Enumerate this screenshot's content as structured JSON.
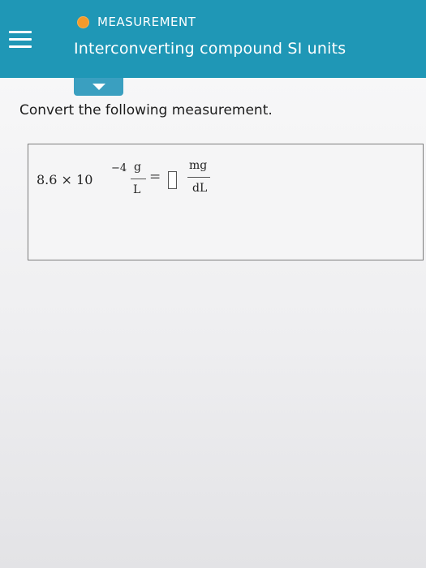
{
  "header": {
    "topic_label": "MEASUREMENT",
    "title": "Interconverting compound SI units",
    "accent_color": "#1f97b6",
    "topic_dot_color": "#f39a2b",
    "menu_icon": "hamburger-menu-icon"
  },
  "toggle": {
    "icon": "caret-down-icon"
  },
  "question": {
    "instruction": "Convert the following measurement.",
    "coefficient": "8.6 × 10",
    "exponent": "−4",
    "given_unit_numerator": "g",
    "given_unit_denominator": "L",
    "equals": "=",
    "answer_value": "",
    "target_unit_numerator": "mg",
    "target_unit_denominator": "dL"
  }
}
